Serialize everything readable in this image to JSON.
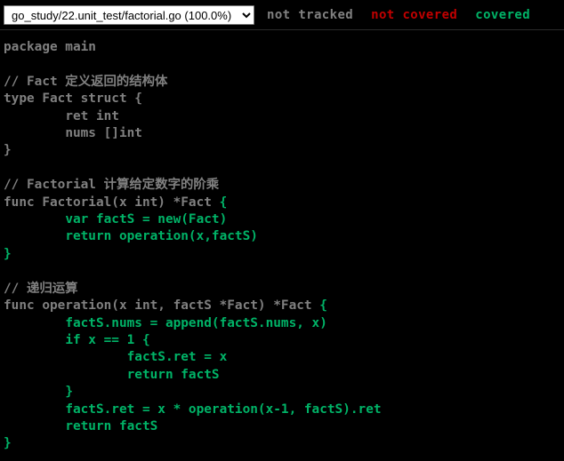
{
  "window": {
    "title": "Go Coverage Report",
    "background_color": "#000000"
  },
  "topbar": {
    "file_select": {
      "icon": "chevron-down-icon",
      "selected_value": "go_study/22.unit_test/factorial.go (100.0%)",
      "options": [
        "go_study/22.unit_test/factorial.go (100.0%)"
      ]
    },
    "legend": {
      "not_tracked_label": "not tracked",
      "not_covered_label": "not covered",
      "covered_label": "covered",
      "not_tracked_color": "#808080",
      "not_covered_color": "#c00000",
      "covered_color": "#00b367"
    }
  },
  "code": {
    "language": "go",
    "file_name": "factorial.go",
    "coverage_percent": "100.0%",
    "segments": [
      {
        "class": "cov0",
        "text": "package main\n\n// Fact 定义返回的结构体\ntype Fact struct {\n\tret int\n\tnums []int\n}\n\n// Factorial 计算给定数字的阶乘\nfunc Factorial(x int) *Fact "
      },
      {
        "class": "cov8",
        "text": "{\n\tvar factS = new(Fact)\n\treturn operation(x,factS)\n}"
      },
      {
        "class": "cov0",
        "text": "\n\n// 递归运算\nfunc operation(x int, factS *Fact) *Fact "
      },
      {
        "class": "cov8",
        "text": "{\n\tfactS.nums = append(factS.nums, x)\n\tif x == 1 "
      },
      {
        "class": "cov8",
        "text": "{\n\t\tfactS.ret = x\n\t\treturn factS\n\t}"
      },
      {
        "class": "cov0",
        "text": "\n\t"
      },
      {
        "class": "cov8",
        "text": "factS.ret = x * operation(x-1, factS).ret\n\treturn factS\n}"
      },
      {
        "class": "cov0",
        "text": "\n"
      }
    ],
    "plain_text": "package main\n\n// Fact 定义返回的结构体\ntype Fact struct {\n\tret int\n\tnums []int\n}\n\n// Factorial 计算给定数字的阶乘\nfunc Factorial(x int) *Fact {\n\tvar factS = new(Fact)\n\treturn operation(x,factS)\n}\n\n// 递归运算\nfunc operation(x int, factS *Fact) *Fact {\n\tfactS.nums = append(factS.nums, x)\n\tif x == 1 {\n\t\tfactS.ret = x\n\t\treturn factS\n\t}\n\tfactS.ret = x * operation(x-1, factS).ret\n\treturn factS\n}\n"
  }
}
